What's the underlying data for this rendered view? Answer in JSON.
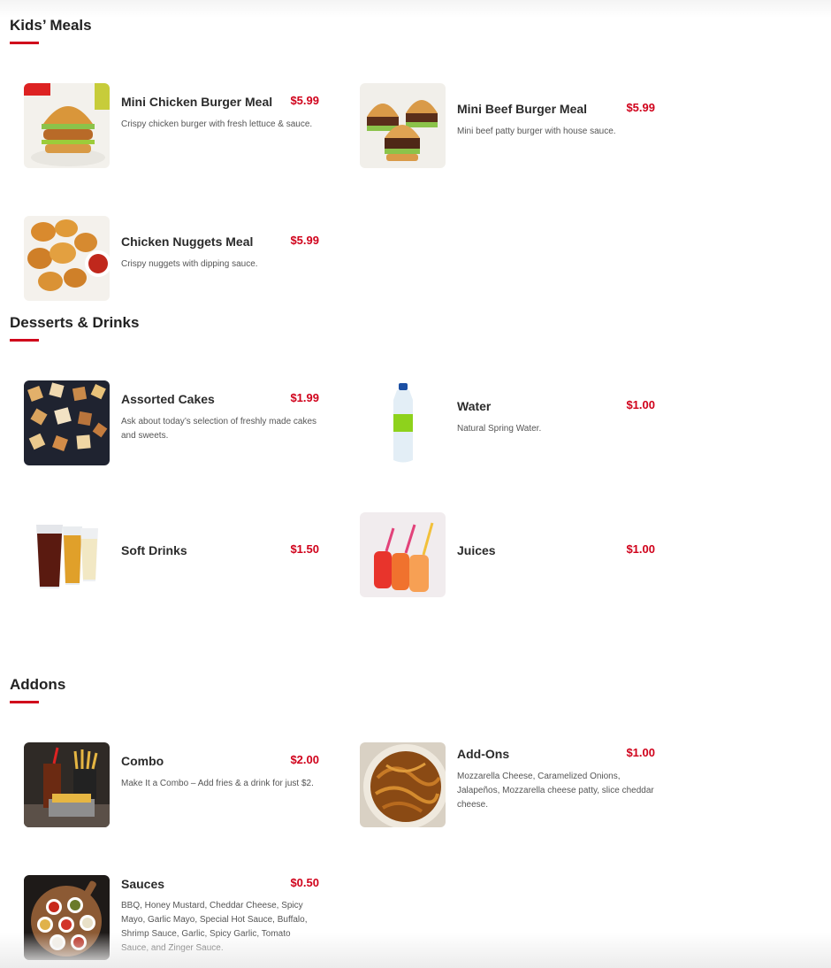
{
  "sections": {
    "kids": {
      "title": "Kids’ Meals",
      "items": [
        {
          "name": "Mini Chicken Burger Meal",
          "price": "$5.99",
          "desc": "Crispy chicken burger with fresh lettuce & sauce."
        },
        {
          "name": "Mini Beef Burger Meal",
          "price": "$5.99",
          "desc": "Mini beef patty burger with house sauce."
        },
        {
          "name": "Chicken Nuggets Meal",
          "price": "$5.99",
          "desc": "Crispy nuggets with dipping sauce."
        }
      ]
    },
    "desserts": {
      "title": "Desserts & Drinks",
      "items": [
        {
          "name": "Assorted Cakes",
          "price": "$1.99",
          "desc": "Ask about today’s selection of freshly made cakes and sweets."
        },
        {
          "name": "Water",
          "price": "$1.00",
          "desc": "Natural Spring Water."
        },
        {
          "name": "Soft Drinks",
          "price": "$1.50",
          "desc": ""
        },
        {
          "name": "Juices",
          "price": "$1.00",
          "desc": ""
        }
      ]
    },
    "addons": {
      "title": "Addons",
      "items": [
        {
          "name": "Combo",
          "price": "$2.00",
          "desc": "Make It a Combo – Add fries & a drink for just $2."
        },
        {
          "name": "Add-Ons",
          "price": "$1.00",
          "desc": "Mozzarella Cheese, Caramelized Onions, Jalapeños, Mozzarella cheese patty, slice cheddar cheese."
        },
        {
          "name": "Sauces",
          "price": "$0.50",
          "desc": "BBQ, Honey Mustard, Cheddar Cheese, Spicy Mayo, Garlic Mayo, Special Hot Sauce, Buffalo, Shrimp Sauce, Garlic, Spicy Garlic, Tomato Sauce, and Zinger Sauce."
        }
      ]
    }
  },
  "theme": {
    "accent": "#d0021b",
    "text": "#2b2b2b"
  }
}
